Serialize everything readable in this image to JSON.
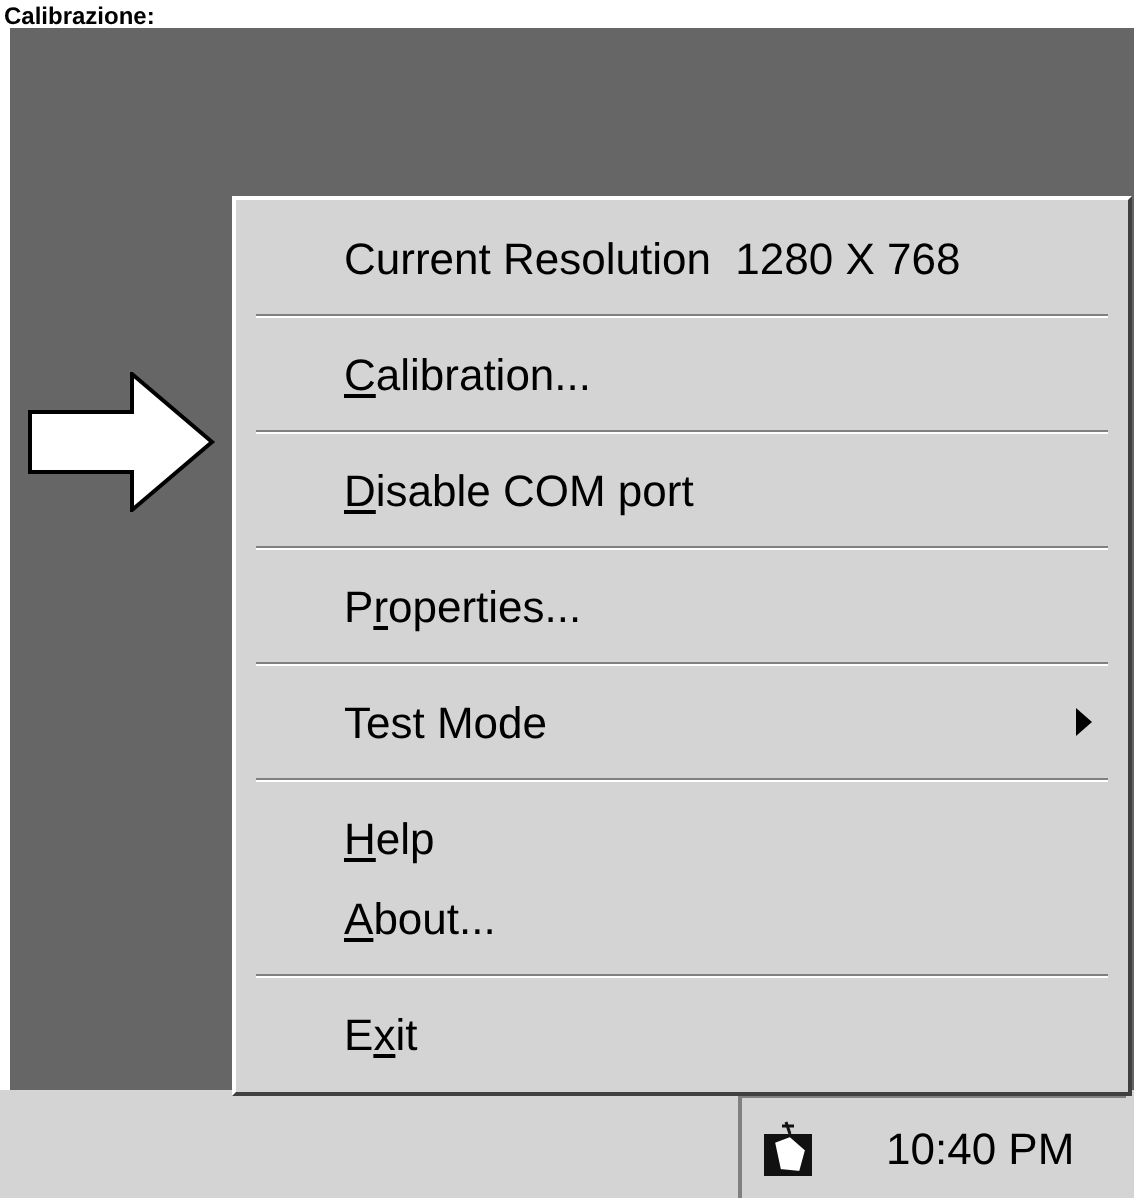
{
  "caption": "Calibrazione:",
  "menu": {
    "groups": [
      [
        {
          "pre": "Current Resolution  1280 X 768",
          "submenu": false
        }
      ],
      [
        {
          "key": "C",
          "post": "alibration...",
          "submenu": false
        }
      ],
      [
        {
          "key": "D",
          "post": "isable COM port",
          "submenu": false
        }
      ],
      [
        {
          "pre": "P",
          "key": "r",
          "post": "operties...",
          "submenu": false
        }
      ],
      [
        {
          "pre": "Test Mode",
          "submenu": true
        }
      ],
      [
        {
          "key": "H",
          "post": "elp",
          "submenu": false
        },
        {
          "key": "A",
          "post": "bout...",
          "submenu": false
        }
      ],
      [
        {
          "pre": "E",
          "key": "x",
          "post": "it",
          "submenu": false
        }
      ]
    ]
  },
  "taskbar": {
    "clock": "10:40 PM"
  }
}
